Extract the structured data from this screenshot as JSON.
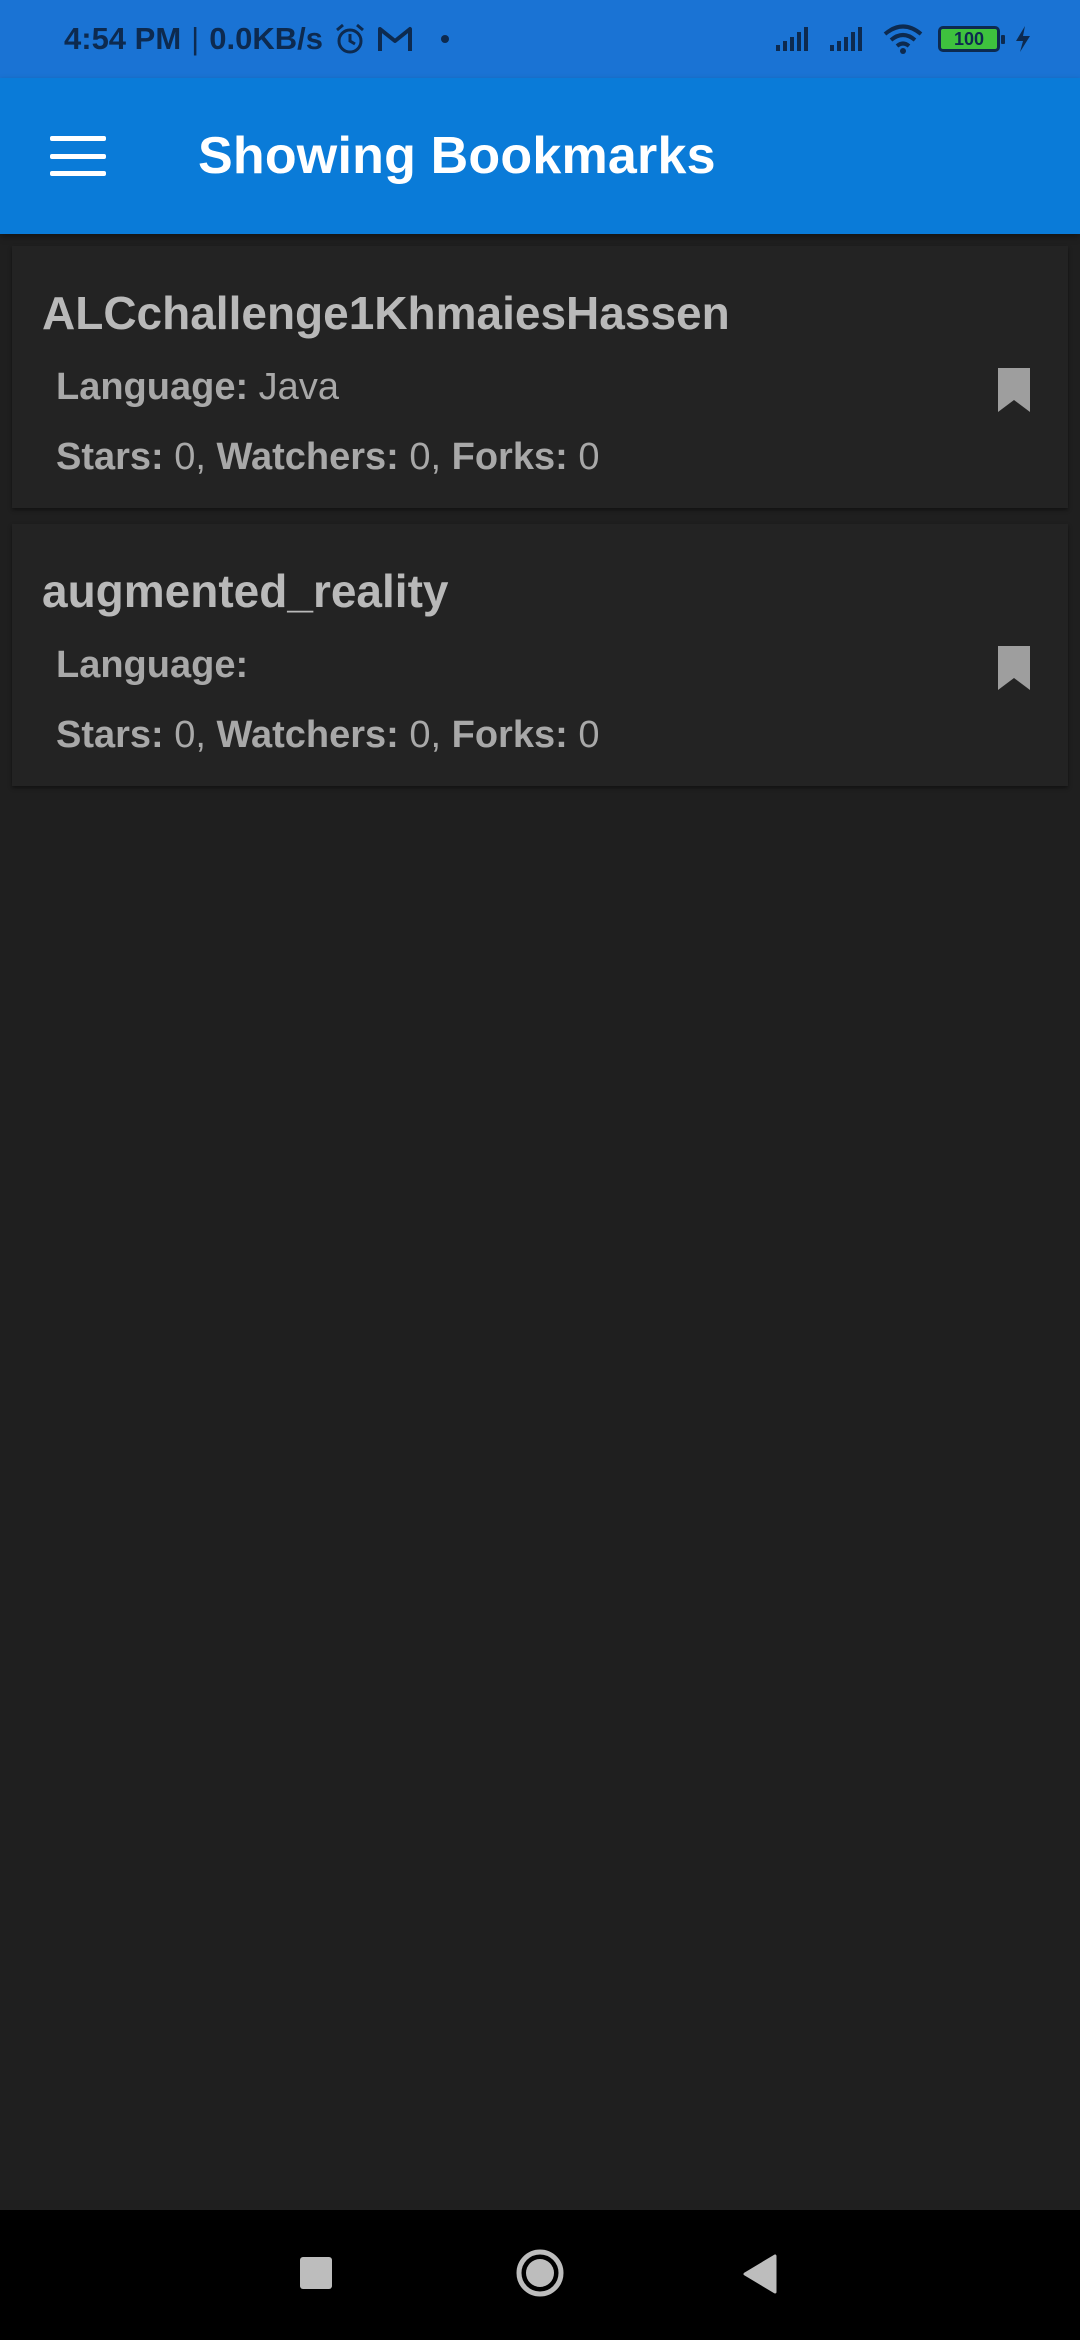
{
  "status_bar": {
    "time": "4:54 PM",
    "separator": "|",
    "speed": "0.0KB/s",
    "battery_level": "100",
    "icons": [
      "alarm-icon",
      "gmail-icon",
      "notification-dot-icon",
      "signal-icon",
      "signal-icon",
      "wifi-icon",
      "battery-icon",
      "charging-icon"
    ]
  },
  "app_bar": {
    "title": "Showing Bookmarks",
    "menu_icon": "hamburger-menu-icon",
    "color": "#0a7bd8"
  },
  "repos": [
    {
      "name": "ALCchallenge1KhmaiesHassen",
      "language_label": "Language:",
      "language": " Java",
      "stars_label": "Stars:",
      "stars": " 0,",
      "watchers_label": " Watchers:",
      "watchers": " 0,",
      "forks_label": " Forks:",
      "forks": " 0",
      "bookmarked": true
    },
    {
      "name": "augmented_reality",
      "language_label": "Language:",
      "language": "",
      "stars_label": "Stars:",
      "stars": " 0,",
      "watchers_label": " Watchers:",
      "watchers": " 0,",
      "forks_label": " Forks:",
      "forks": " 0",
      "bookmarked": true
    }
  ],
  "nav_bar": {
    "buttons": [
      "recents-square-icon",
      "home-circle-icon",
      "back-triangle-icon"
    ]
  }
}
